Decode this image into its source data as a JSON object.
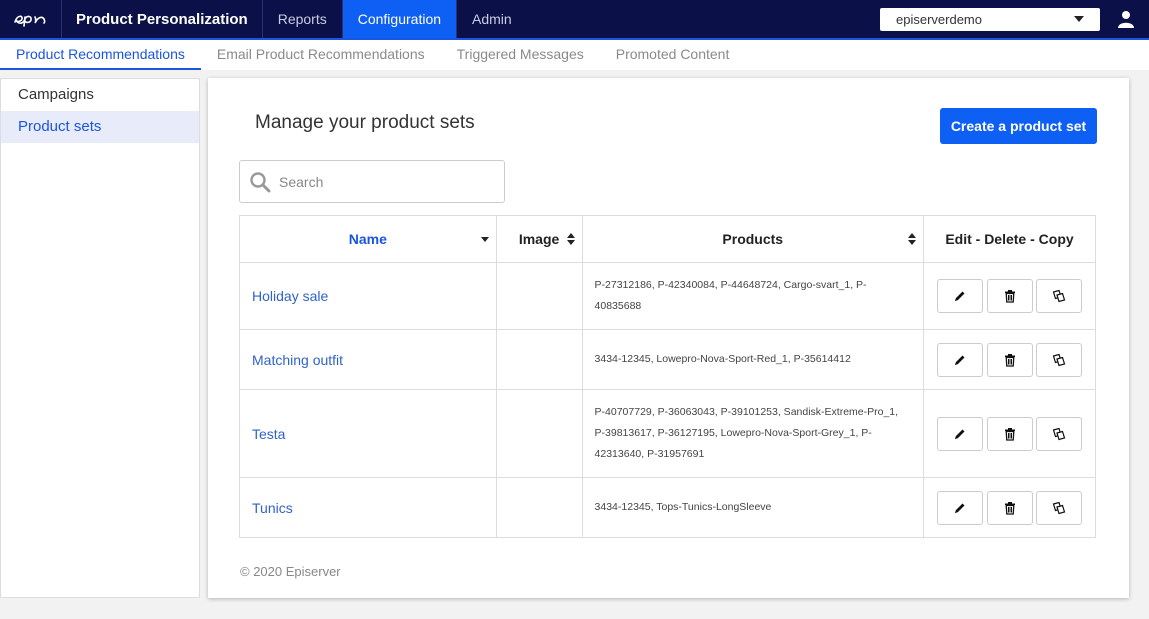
{
  "topbar": {
    "logo": "epi",
    "brand": "Product Personalization",
    "nav": [
      {
        "label": "Reports",
        "active": false
      },
      {
        "label": "Configuration",
        "active": true
      },
      {
        "label": "Admin",
        "active": false
      }
    ],
    "site_select_value": "episerverdemo",
    "user_icon": "user-icon"
  },
  "subnav": {
    "tabs": [
      {
        "label": "Product Recommendations",
        "active": true
      },
      {
        "label": "Email Product Recommendations",
        "active": false
      },
      {
        "label": "Triggered Messages",
        "active": false
      },
      {
        "label": "Promoted Content",
        "active": false
      }
    ]
  },
  "sidebar": {
    "items": [
      {
        "label": "Campaigns",
        "active": false
      },
      {
        "label": "Product sets",
        "active": true
      }
    ]
  },
  "main": {
    "title": "Manage your product sets",
    "create_button": "Create a product set",
    "search_placeholder": "Search",
    "table": {
      "headers": {
        "name": "Name",
        "image": "Image",
        "products": "Products",
        "actions": "Edit - Delete - Copy"
      },
      "rows": [
        {
          "name": "Holiday sale",
          "products": "P-27312186, P-42340084, P-44648724, Cargo-svart_1, P-40835688"
        },
        {
          "name": "Matching outfit",
          "products": "3434-12345, Lowepro-Nova-Sport-Red_1, P-35614412"
        },
        {
          "name": "Testa",
          "products": "P-40707729, P-36063043, P-39101253, Sandisk-Extreme-Pro_1, P-39813617, P-36127195, Lowepro-Nova-Sport-Grey_1, P-42313640, P-31957691"
        },
        {
          "name": "Tunics",
          "products": "3434-12345, Tops-Tunics-LongSleeve"
        }
      ]
    },
    "footer": "© 2020 Episerver"
  },
  "colors": {
    "navbar": "#0b1148",
    "accent": "#0e5ff3",
    "link": "#2f63c8"
  }
}
